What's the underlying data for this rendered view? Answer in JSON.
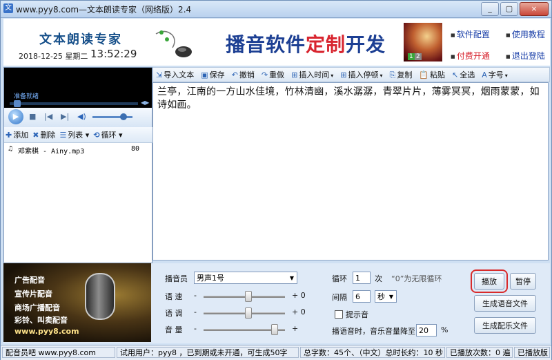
{
  "window": {
    "title": "www.pyy8.com—文本朗读专家（网络版）2.4",
    "buttons": [
      "_",
      "▢",
      "×"
    ]
  },
  "banner": {
    "app_name": "文本朗读专家",
    "date": "2018-12-25",
    "weekday": "星期二",
    "time": "13:52:29",
    "slogan_part1": "播音软件",
    "slogan_part2": "定制",
    "slogan_part3": "开发",
    "promo_nums": [
      "1",
      "2"
    ],
    "links": [
      "软件配置",
      "使用教程",
      "付费开通",
      "退出登陆"
    ]
  },
  "player": {
    "status": "准备就绪",
    "progress_arrows": "◀▶"
  },
  "list_toolbar": [
    "添加",
    "删除",
    "列表",
    "循环"
  ],
  "playlist": [
    {
      "name": "邓紫棋 - Ainy.mp3",
      "duration": "80"
    }
  ],
  "edit_toolbar": [
    "导入文本",
    "保存",
    "撤销",
    "重做",
    "插入时间",
    "插入停顿",
    "复制",
    "粘贴",
    "全选",
    "字号"
  ],
  "editor": {
    "text": "兰亭，江南的一方山水佳境，竹林清幽，溪水潺潺，青翠片片，薄雾冥冥，烟雨蒙蒙，如诗如画。"
  },
  "ad": {
    "lines": [
      "广告配音",
      "宣传片配音",
      "商场广播配音",
      "彩铃、叫卖配音"
    ],
    "url": "www.pyy8.com"
  },
  "controls": {
    "announcer_label": "播音员",
    "announcer_value": "男声1号",
    "speed_label": "语 速",
    "tone_label": "语 调",
    "volume_label": "音 量",
    "minus": "-",
    "speed_value": "+ 0",
    "tone_value": "+ 0",
    "volume_value": "+",
    "loop_label": "循环",
    "loop_value": "1",
    "loop_unit": "次",
    "loop_hint": "“0”为无限循环",
    "interval_label": "间隔",
    "interval_value": "6",
    "interval_unit": "秒",
    "sound_hint_label": "提示音",
    "bgm_label": "播语音时，音乐音量降至",
    "bgm_value": "20",
    "bgm_unit": "%",
    "play": "播放",
    "pause": "暂停",
    "gen_voice": "生成语音文件",
    "gen_music": "生成配乐文件"
  },
  "statusbar": {
    "site": "配音员吧  www.pyy8.com",
    "trial": "试用用户：pyy8 ，已到期或未开通，可生成50字",
    "stats": "总字数：45个、（中文）总时长约：10 秒",
    "played": "已播放次数：0 遍",
    "version": "已播放版"
  }
}
